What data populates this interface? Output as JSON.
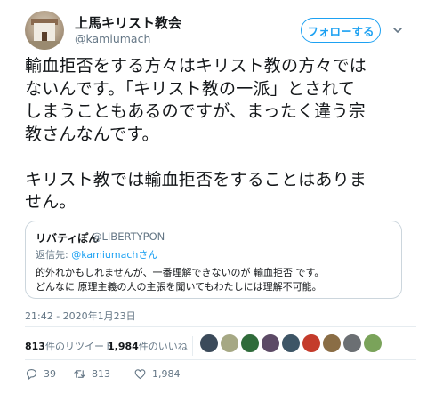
{
  "author": {
    "display_name": "上馬キリスト教会",
    "handle": "@kamiumach",
    "follow_label": "フォローする"
  },
  "tweet": {
    "text": "輸血拒否をする方々はキリスト教の方々では\nないんです。「キリスト教の一派」とされて\nしまうこともあるのですが、まったく違う宗\n教さんなんです。\n\nキリスト教では輸血拒否をすることはありま\nせん。",
    "timestamp": "21:42 - 2020年1月23日"
  },
  "quoted_tweet": {
    "display_name": "リバティぽん",
    "handle": "@LIBERTYPON",
    "reply_prefix": "返信先: ",
    "reply_to": "@kamiumachさん",
    "body": "的外れかもしれませんが、一番理解できないのが 輸血拒否 です。\nどんなに 原理主義の人の主張を聞いてもわたしには理解不可能。"
  },
  "stats": {
    "retweet_count": "813",
    "retweet_label": "件のリツイート",
    "like_count": "1,984",
    "like_label": "件のいいね"
  },
  "liker_avatars": [
    {
      "name": "liker-avatar-1",
      "color": "#3b4a5a"
    },
    {
      "name": "liker-avatar-2",
      "color": "#a6a884"
    },
    {
      "name": "liker-avatar-3",
      "color": "#2f6b3a"
    },
    {
      "name": "liker-avatar-4",
      "color": "#5c4a66"
    },
    {
      "name": "liker-avatar-5",
      "color": "#3d5566"
    },
    {
      "name": "liker-avatar-6",
      "color": "#c43b2b"
    },
    {
      "name": "liker-avatar-7",
      "color": "#8a6d45"
    },
    {
      "name": "liker-avatar-8",
      "color": "#6b6f73"
    },
    {
      "name": "liker-avatar-9",
      "color": "#7aa35a"
    }
  ],
  "actions": {
    "reply_count": "39",
    "retweet_count": "813",
    "like_count": "1,984"
  },
  "colors": {
    "accent": "#1da1f2",
    "secondary_text": "#657786",
    "primary_text": "#14171a",
    "border": "#e6ecf0"
  }
}
